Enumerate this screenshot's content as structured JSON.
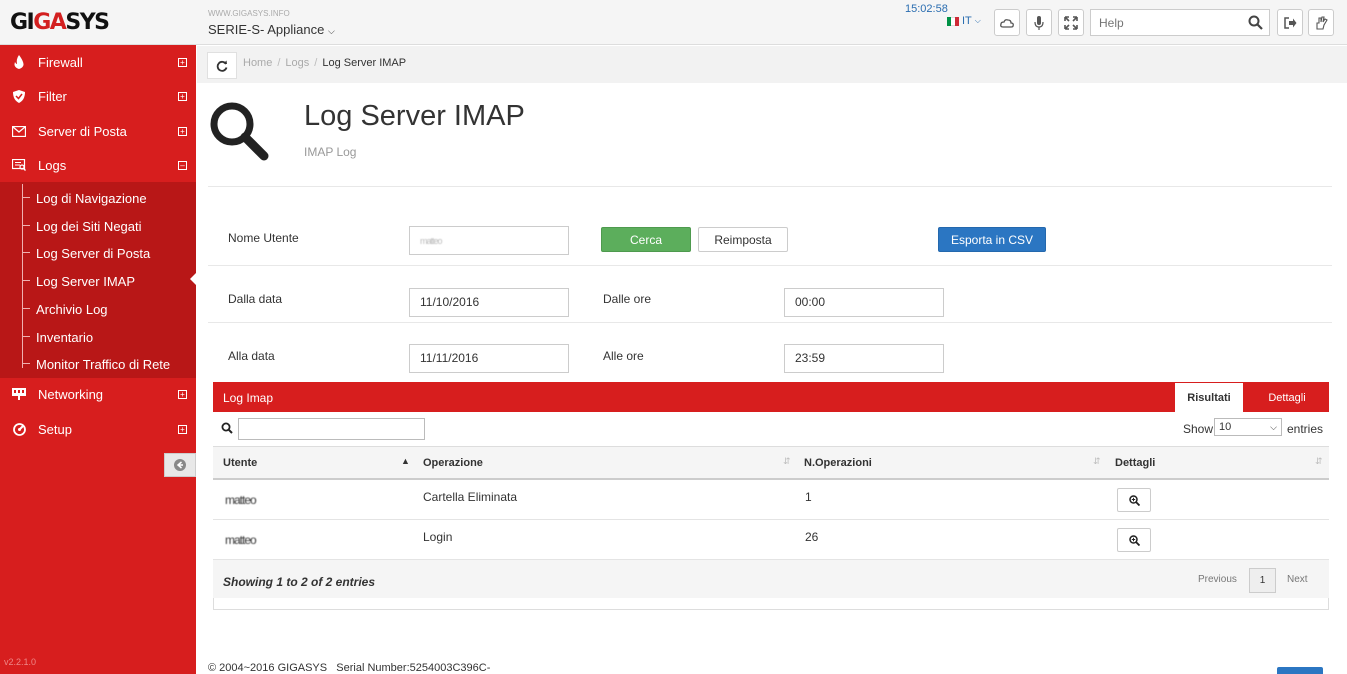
{
  "header": {
    "logo": {
      "gi": "GI",
      "ga": "GA",
      "sys": "SYS"
    },
    "site_url": "WWW.GIGASYS.INFO",
    "appliance": "SERIE-S- Appliance",
    "clock": "15:02:58",
    "language": "IT",
    "help_placeholder": "Help",
    "flag_colors": [
      "#009246",
      "#ffffff",
      "#ce2b37"
    ]
  },
  "sidebar": {
    "items": [
      {
        "label": "Firewall",
        "icon": "flame-icon"
      },
      {
        "label": "Filter",
        "icon": "shield-icon"
      },
      {
        "label": "Server di Posta",
        "icon": "envelope-icon"
      },
      {
        "label": "Logs",
        "icon": "logs-icon"
      },
      {
        "label": "Networking",
        "icon": "network-icon"
      },
      {
        "label": "Setup",
        "icon": "setup-icon"
      }
    ],
    "logs_sub": [
      "Log di Navigazione",
      "Log dei Siti Negati",
      "Log Server di Posta",
      "Log Server IMAP",
      "Archivio Log",
      "Inventario",
      "Monitor Traffico di Rete"
    ],
    "version": "v2.2.1.0"
  },
  "breadcrumb": {
    "home": "Home",
    "logs": "Logs",
    "current": "Log Server IMAP"
  },
  "page": {
    "title": "Log Server IMAP",
    "subtitle": "IMAP Log"
  },
  "form": {
    "user_label": "Nome Utente",
    "user_value": "matteo",
    "search_btn": "Cerca",
    "reset_btn": "Reimposta",
    "export_btn": "Esporta in CSV",
    "from_date_label": "Dalla data",
    "from_date": "11/10/2016",
    "from_time_label": "Dalle ore",
    "from_time": "00:00",
    "to_date_label": "Alla data",
    "to_date": "11/11/2016",
    "to_time_label": "Alle ore",
    "to_time": "23:59"
  },
  "panel": {
    "title": "Log Imap",
    "tab_results": "Risultati",
    "tab_details": "Dettagli",
    "show_label": "Show",
    "show_value": "10",
    "entries_label": "entries",
    "columns": [
      "Utente",
      "Operazione",
      "N.Operazioni",
      "Dettagli"
    ],
    "rows": [
      {
        "user": "matteo",
        "operation": "Cartella Eliminata",
        "count": "1"
      },
      {
        "user": "matteo",
        "operation": "Login",
        "count": "26"
      }
    ],
    "showing": "Showing 1 to 2 of 2 entries",
    "prev": "Previous",
    "page": "1",
    "next": "Next"
  },
  "footer": {
    "copyright": "© 2004~2016 GIGASYS",
    "serial": "Serial Number:5254003C396C-"
  }
}
